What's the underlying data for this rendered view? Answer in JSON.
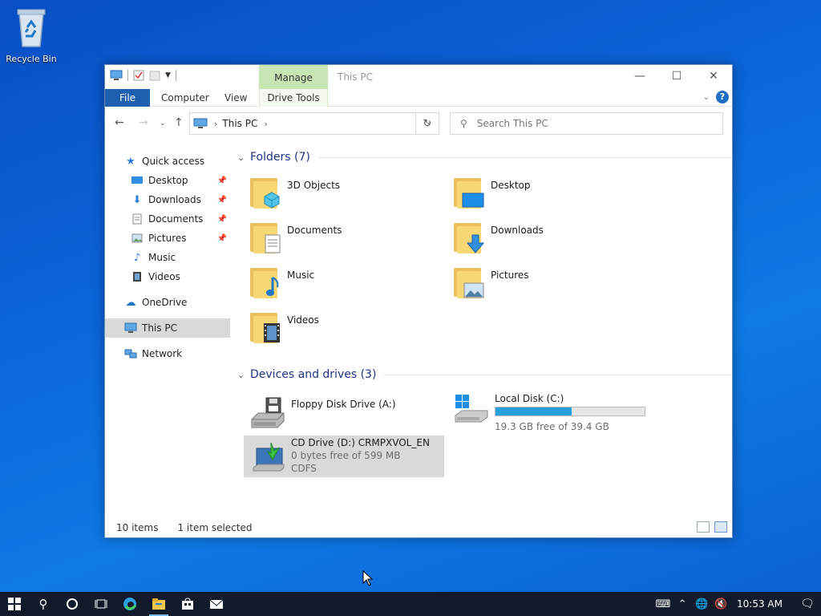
{
  "desktop": {
    "icons": [
      {
        "label": "Recycle Bin",
        "icon": "recycle-bin-icon"
      }
    ]
  },
  "window": {
    "title": "This PC",
    "context_tab_label": "Manage",
    "ribbon_tabs": [
      "File",
      "Computer",
      "View",
      "Drive Tools"
    ],
    "address": {
      "path_label": "This PC"
    },
    "search": {
      "placeholder": "Search This PC",
      "value": ""
    },
    "nav_pane": {
      "quick_access": {
        "label": "Quick access",
        "icon": "star-icon"
      },
      "items": [
        {
          "label": "Desktop",
          "pinned": true,
          "icon": "desktop-icon"
        },
        {
          "label": "Downloads",
          "pinned": true,
          "icon": "download-arrow-icon"
        },
        {
          "label": "Documents",
          "pinned": true,
          "icon": "document-icon"
        },
        {
          "label": "Pictures",
          "pinned": true,
          "icon": "picture-icon"
        },
        {
          "label": "Music",
          "pinned": false,
          "icon": "music-note-icon"
        },
        {
          "label": "Videos",
          "pinned": false,
          "icon": "film-icon"
        }
      ],
      "onedrive": {
        "label": "OneDrive",
        "icon": "cloud-icon"
      },
      "this_pc": {
        "label": "This PC",
        "icon": "computer-icon",
        "selected": true
      },
      "network": {
        "label": "Network",
        "icon": "network-icon"
      }
    },
    "folders_group": {
      "header": "Folders (7)",
      "items": [
        {
          "name": "3D Objects",
          "icon": "cube-icon"
        },
        {
          "name": "Desktop",
          "icon": "desktop-icon"
        },
        {
          "name": "Documents",
          "icon": "document-icon"
        },
        {
          "name": "Downloads",
          "icon": "download-arrow-icon"
        },
        {
          "name": "Music",
          "icon": "music-note-icon"
        },
        {
          "name": "Pictures",
          "icon": "picture-icon"
        },
        {
          "name": "Videos",
          "icon": "film-icon"
        }
      ]
    },
    "drives_group": {
      "header": "Devices and drives (3)",
      "drives": [
        {
          "name": "Floppy Disk Drive (A:)",
          "icon": "floppy-drive-icon"
        },
        {
          "name": "Local Disk (C:)",
          "free_text": "19.3 GB free of 39.4 GB",
          "used_fraction": 0.51,
          "icon": "windows-drive-icon"
        },
        {
          "name": "CD Drive (D:) CRMPXVOL_EN",
          "free_text": "0 bytes free of 599 MB",
          "filesystem": "CDFS",
          "icon": "cd-drive-icon",
          "selected": true
        }
      ]
    },
    "status": {
      "items_count": "10 items",
      "selection": "1 item selected"
    }
  },
  "taskbar": {
    "clock": "10:53 AM",
    "apps": [
      "start-icon",
      "search-icon",
      "cortana-icon",
      "task-view-icon",
      "edge-icon",
      "file-explorer-icon",
      "store-icon",
      "mail-icon"
    ]
  },
  "colors": {
    "accent": "#1f5fb0",
    "manage_tab": "#c8e6b4",
    "capacity_fill": "#26a0da",
    "selection": "#d9d9d9",
    "group_header": "#1e3287"
  }
}
